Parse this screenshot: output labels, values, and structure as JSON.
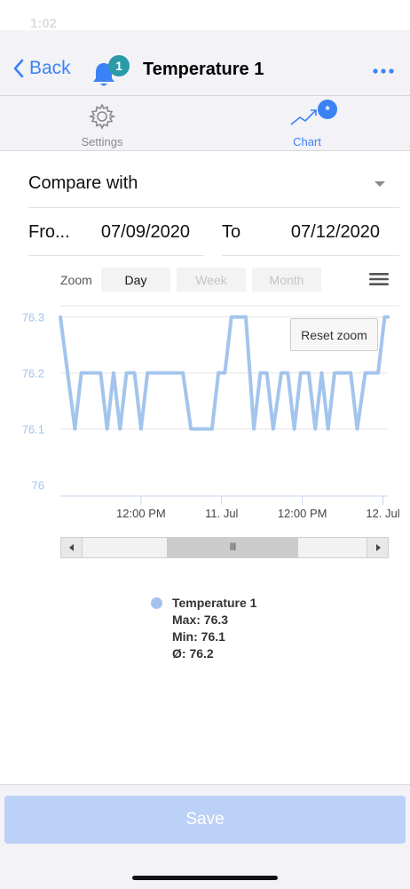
{
  "status": {
    "time": "1:02"
  },
  "nav": {
    "back_label": "Back",
    "bell_badge": "1",
    "title": "Temperature 1"
  },
  "tabs": [
    {
      "label": "Settings",
      "icon": "gear-icon",
      "active": false
    },
    {
      "label": "Chart",
      "icon": "chart-icon",
      "active": true,
      "badge": "*"
    }
  ],
  "compare": {
    "label": "Compare with"
  },
  "date_range": {
    "from_label": "Fro...",
    "from_value": "07/09/2020",
    "to_label": "To",
    "to_value": "07/12/2020"
  },
  "zoom": {
    "label": "Zoom",
    "options": [
      "Day",
      "Week",
      "Month"
    ],
    "selected": "Day"
  },
  "reset_zoom_label": "Reset zoom",
  "scrollbar": {
    "thumb_label": "III"
  },
  "legend": {
    "series_name": "Temperature 1",
    "max_line": "Max: 76.3",
    "min_line": "Min: 76.1",
    "avg_line": "Ø: 76.2"
  },
  "save_label": "Save",
  "colors": {
    "accent": "#3b82f6",
    "series": "#a3c4ec",
    "badge_teal": "#2a9aa8",
    "save_disabled": "#bcd1f6"
  },
  "chart_data": {
    "type": "line",
    "yticks": [
      76,
      76.1,
      76.2,
      76.3
    ],
    "ytick_labels": [
      "76",
      "76.1",
      "76.2",
      "76.3"
    ],
    "xticks": [
      {
        "label": "12:00 PM",
        "x": 0.5
      },
      {
        "label": "11. Jul",
        "x": 1.0
      },
      {
        "label": "12:00 PM",
        "x": 1.5
      },
      {
        "label": "12. Jul",
        "x": 2.0
      }
    ],
    "xlim": [
      0.0,
      2.03
    ],
    "ylim": [
      75.98,
      76.32
    ],
    "grid": true,
    "series": [
      {
        "name": "Temperature 1",
        "points": [
          [
            0.0,
            76.3
          ],
          [
            0.09,
            76.1
          ],
          [
            0.13,
            76.2
          ],
          [
            0.25,
            76.2
          ],
          [
            0.29,
            76.1
          ],
          [
            0.33,
            76.2
          ],
          [
            0.37,
            76.1
          ],
          [
            0.41,
            76.2
          ],
          [
            0.46,
            76.2
          ],
          [
            0.5,
            76.1
          ],
          [
            0.54,
            76.2
          ],
          [
            0.76,
            76.2
          ],
          [
            0.81,
            76.1
          ],
          [
            0.94,
            76.1
          ],
          [
            0.98,
            76.2
          ],
          [
            1.02,
            76.2
          ],
          [
            1.06,
            76.3
          ],
          [
            1.15,
            76.3
          ],
          [
            1.2,
            76.1
          ],
          [
            1.24,
            76.2
          ],
          [
            1.28,
            76.2
          ],
          [
            1.32,
            76.1
          ],
          [
            1.37,
            76.2
          ],
          [
            1.41,
            76.2
          ],
          [
            1.45,
            76.1
          ],
          [
            1.49,
            76.2
          ],
          [
            1.54,
            76.2
          ],
          [
            1.58,
            76.1
          ],
          [
            1.62,
            76.2
          ],
          [
            1.66,
            76.1
          ],
          [
            1.7,
            76.2
          ],
          [
            1.8,
            76.2
          ],
          [
            1.84,
            76.1
          ],
          [
            1.89,
            76.2
          ],
          [
            1.97,
            76.2
          ],
          [
            2.01,
            76.3
          ],
          [
            2.03,
            76.3
          ]
        ]
      }
    ]
  }
}
